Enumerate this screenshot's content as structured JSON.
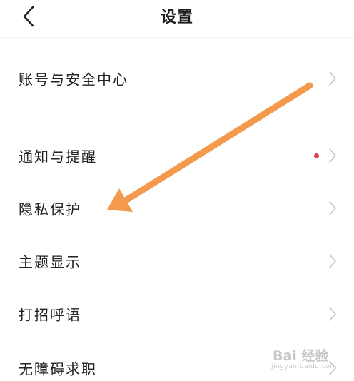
{
  "header": {
    "title": "设置",
    "back_icon": "chevron-left-icon"
  },
  "settings": {
    "items": [
      {
        "label": "账号与安全中心",
        "has_dot": false
      },
      {
        "label": "通知与提醒",
        "has_dot": true
      },
      {
        "label": "隐私保护",
        "has_dot": false
      },
      {
        "label": "主题显示",
        "has_dot": false
      },
      {
        "label": "打招呼语",
        "has_dot": false
      },
      {
        "label": "无障碍求职",
        "has_dot": false
      }
    ],
    "chevron_icon": "chevron-right-icon",
    "dot_color": "#d6434f"
  },
  "annotation": {
    "arrow_color": "#f39a4d",
    "points_to": "隐私保护"
  },
  "watermark": {
    "brand": "Bai 经验",
    "sub": "jingyan.baidu.com"
  },
  "colors": {
    "background": "#ffffff",
    "text": "#222222",
    "chevron": "#c4c4c4"
  }
}
